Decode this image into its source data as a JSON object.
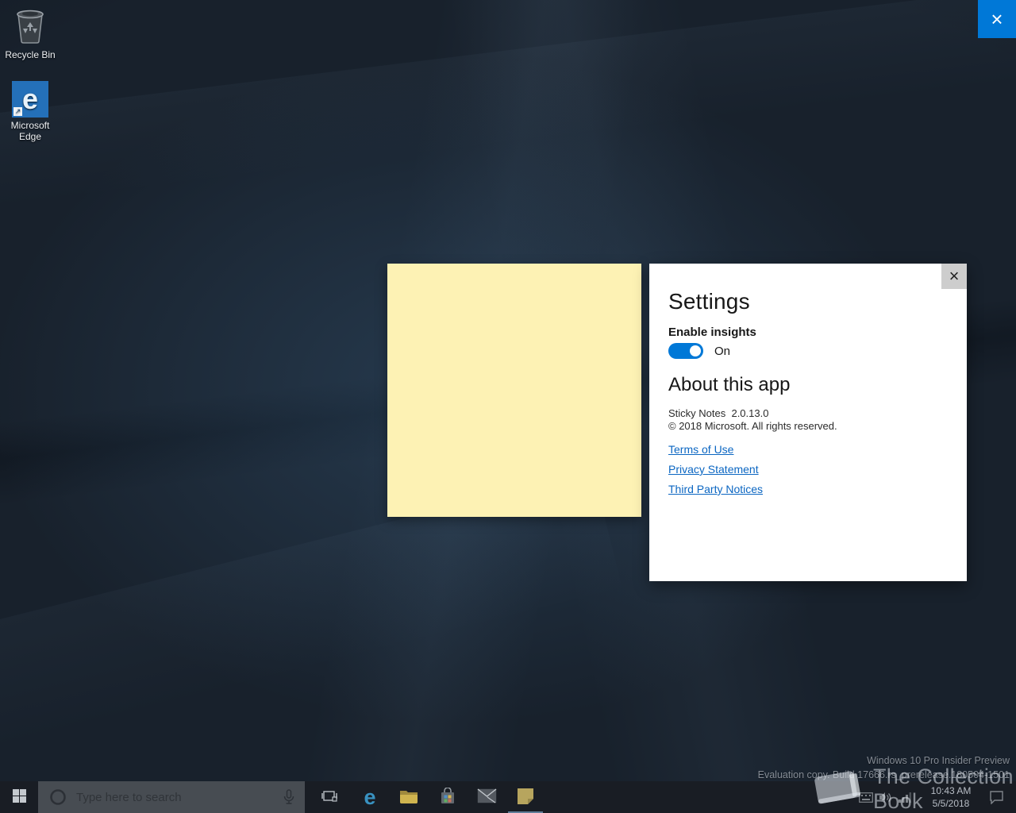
{
  "desktop": {
    "icons": [
      {
        "label": "Recycle Bin"
      },
      {
        "label": "Microsoft Edge"
      }
    ]
  },
  "icons": {
    "close": "×",
    "edge_letter": "e",
    "shortcut_arrow": "↗"
  },
  "settings_panel": {
    "title": "Settings",
    "enable_insights_label": "Enable insights",
    "toggle_state": "On",
    "about_title": "About this app",
    "app_version": "Sticky Notes  2.0.13.0",
    "copyright": "© 2018 Microsoft. All rights reserved.",
    "links": [
      {
        "label": "Terms of Use"
      },
      {
        "label": "Privacy Statement"
      },
      {
        "label": "Third Party Notices"
      }
    ]
  },
  "taskbar": {
    "search_placeholder": "Type here to search",
    "tray": {
      "time": "10:43 AM",
      "date": "5/5/2018"
    }
  },
  "system_info": {
    "line1": "Windows 10 Pro Insider Preview",
    "line2": "Evaluation copy. Build 17666.rs_prerelease.180504-1501"
  },
  "watermark": {
    "text": "The Collection Book"
  },
  "colors": {
    "accent": "#0078d7",
    "note_yellow": "#fdf2b4",
    "link_blue": "#0b66c2",
    "taskbar_bg": "#191d24"
  }
}
